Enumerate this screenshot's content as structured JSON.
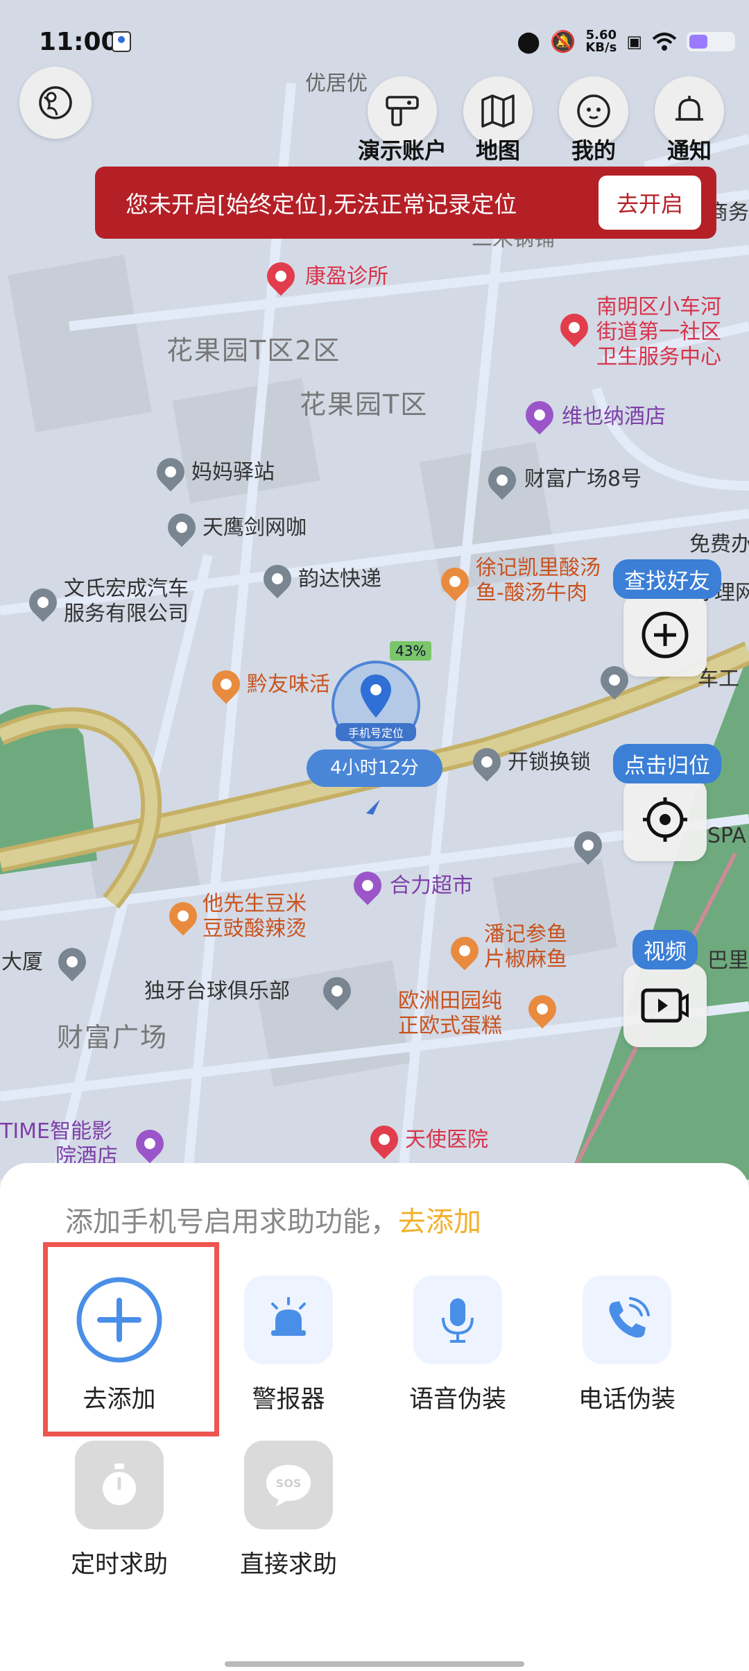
{
  "status_bar": {
    "time": "11:00",
    "net_speed_value": "5.60",
    "net_speed_unit": "KB/s",
    "icons": [
      "location-icon",
      "mute-icon",
      "wifi-icon",
      "battery-icon"
    ]
  },
  "top_nav": {
    "items": [
      {
        "label": "演示账户",
        "icon": "account-icon"
      },
      {
        "label": "地图",
        "icon": "map-icon"
      },
      {
        "label": "我的",
        "icon": "profile-icon"
      },
      {
        "label": "通知",
        "icon": "bell-icon"
      }
    ]
  },
  "warning_banner": {
    "text": "您未开启[始终定位],无法正常记录定位",
    "button": "去开启",
    "color": "#b52027"
  },
  "side_tools": {
    "find_friend": "查找好友",
    "locate": "点击归位",
    "video": "视频"
  },
  "device": {
    "battery": "43%",
    "name": "手机号定位",
    "duration": "4小时12分"
  },
  "map_labels": {
    "l1": "优居优",
    "l2": "康盈诊所",
    "l3": "花果园T区2区",
    "l4": "花果园T区",
    "l5": "南明区小车河",
    "l6": "街道第一社区",
    "l7": "卫生服务中心",
    "l8": "维也纳酒店",
    "l9": "妈妈驿站",
    "l10": "财富广场8号",
    "l11": "天鹰剑网咖",
    "l12": "文氏宏成汽车",
    "l13": "服务有限公司",
    "l14": "韵达快递",
    "l15": "徐记凯里酸汤",
    "l16": "鱼-酸汤牛肉",
    "l17": "黔友味活",
    "l18": "开锁换锁",
    "l19": "合力超市",
    "l20": "他先生豆米",
    "l21": "豆豉酸辣烫",
    "l22": "潘记参鱼",
    "l23": "片椒麻鱼",
    "l24": "大厦",
    "l25": "独牙台球俱乐部",
    "l26": "欧洲田园纯",
    "l27": "正欧式蛋糕",
    "l28": "财富广场",
    "l29": "TIME智能影",
    "l30": "院酒店",
    "l31": "天使医院",
    "l32": "免费办",
    "l33": "车工",
    "l34": "SPA",
    "l35": "巴里冲",
    "l36": "二米钢铺",
    "l37": "商务",
    "l38": "办理网"
  },
  "sheet": {
    "prompt": "添加手机号启用求助功能，",
    "prompt_link": "去添加",
    "features": [
      {
        "label": "去添加",
        "icon": "add-circle-icon",
        "highlighted": true
      },
      {
        "label": "警报器",
        "icon": "siren-icon"
      },
      {
        "label": "语音伪装",
        "icon": "microphone-icon"
      },
      {
        "label": "电话伪装",
        "icon": "phone-call-icon"
      },
      {
        "label": "定时求助",
        "icon": "stopwatch-icon"
      },
      {
        "label": "直接求助",
        "icon": "sos-bubble-icon"
      }
    ],
    "highlight_color": "#ee5550",
    "accent_color": "#f3b02a"
  }
}
